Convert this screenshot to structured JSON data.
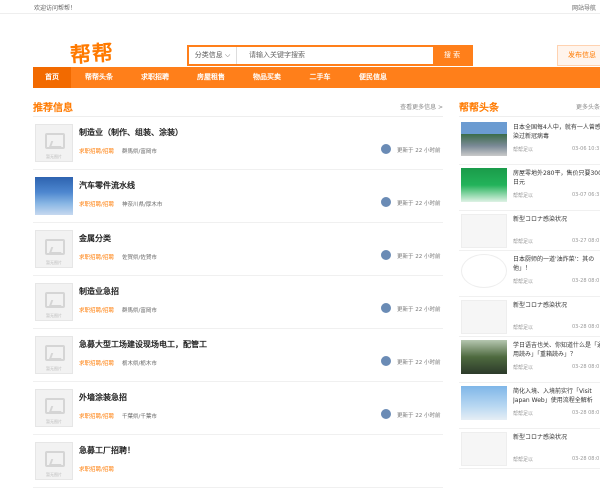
{
  "topbar": {
    "left": "欢迎访问帮帮！",
    "right": "网站导航"
  },
  "header": {
    "logo": "帮帮",
    "search_category": "分类信息 ⌵",
    "search_placeholder": "请输入关键字搜索",
    "search_button": "搜 索",
    "publish_button": "发布信息"
  },
  "nav": [
    "首页",
    "帮帮头条",
    "求职招聘",
    "房屋租售",
    "物品买卖",
    "二手车",
    "便民信息"
  ],
  "left_section": {
    "title": "推荐信息",
    "more": "查看更多信息 >"
  },
  "listings": [
    {
      "title": "制造业（制作、组装、涂装）",
      "tag": "求职招聘/招聘",
      "loc": "群馬県/富岡市",
      "updated": "更新于 22 小时前",
      "thumb": "placeholder"
    },
    {
      "title": "汽车零件流水线",
      "tag": "求职招聘/招聘",
      "loc": "神奈川県/厚木市",
      "updated": "更新于 22 小时前",
      "thumb": "photo"
    },
    {
      "title": "金属分类",
      "tag": "求职招聘/招聘",
      "loc": "佐賀県/佐賀市",
      "updated": "更新于 22 小时前",
      "thumb": "placeholder"
    },
    {
      "title": "制造业急招",
      "tag": "求职招聘/招聘",
      "loc": "群馬県/富岡市",
      "updated": "更新于 22 小时前",
      "thumb": "placeholder"
    },
    {
      "title": "急募大型工场建设现场电工，配管工",
      "tag": "求职招聘/招聘",
      "loc": "栃木県/栃木市",
      "updated": "更新于 22 小时前",
      "thumb": "placeholder"
    },
    {
      "title": "外墙涂装急招",
      "tag": "求职招聘/招聘",
      "loc": "千葉県/千葉市",
      "updated": "更新于 22 小时前",
      "thumb": "placeholder"
    },
    {
      "title": "急募工厂招聘！",
      "tag": "求职招聘/招聘",
      "loc": "",
      "updated": "",
      "thumb": "placeholder"
    }
  ],
  "right_section": {
    "title": "帮帮头条",
    "more": "更多头条"
  },
  "news": [
    {
      "title": "日本全国每4人中，就有一人曾感染过新冠病毒",
      "src": "帮帮足以",
      "date": "03-06 10:3",
      "img": "crowd"
    },
    {
      "title": "房屋零地外280平，售价只要300日元",
      "src": "帮帮足以",
      "date": "03-07 06:3",
      "img": "green"
    },
    {
      "title": "新型コロナ感染状况",
      "src": "帮帮足以",
      "date": "03-27 08:0",
      "img": "none"
    },
    {
      "title": "日本厨师的一道'油炸菜'：其の他」！",
      "src": "帮帮足以",
      "date": "03-28 08:0",
      "img": "cartoon"
    },
    {
      "title": "新型コロナ感染状况",
      "src": "帮帮足以",
      "date": "03-28 08:0",
      "img": "none"
    },
    {
      "title": "学日语吉也关、你知道什么是「通用読み」「重箱読み」？",
      "src": "帮帮足以",
      "date": "03-28 08:0",
      "img": "students"
    },
    {
      "title": "简化入境、入境前实行「Visit Japan Web」使用流程全解析",
      "src": "帮帮足以",
      "date": "03-28 08:0",
      "img": "plane"
    },
    {
      "title": "新型コロナ感染状况",
      "src": "帮帮足以",
      "date": "03-28 08:0",
      "img": "none"
    }
  ],
  "colors": {
    "accent": "#ff7f1a",
    "nav_active": "#f26a00"
  },
  "placeholder_caption": "暂无图片"
}
